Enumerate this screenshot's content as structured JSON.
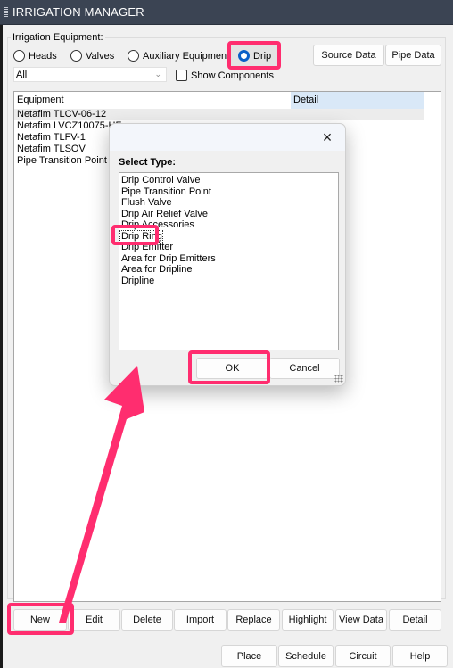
{
  "window": {
    "title": "IRRIGATION MANAGER"
  },
  "equipment_group": {
    "label": "Irrigation Equipment:",
    "radios": [
      {
        "label": "Heads",
        "selected": false
      },
      {
        "label": "Valves",
        "selected": false
      },
      {
        "label": "Auxiliary Equipment",
        "selected": false
      },
      {
        "label": "Drip",
        "selected": true
      }
    ],
    "filter_select": {
      "value": "All"
    },
    "show_components": {
      "label": "Show Components",
      "checked": false
    },
    "source_data_label": "Source Data",
    "pipe_data_label": "Pipe Data"
  },
  "equipment_list": {
    "columns": [
      "Equipment",
      "Detail"
    ],
    "rows": [
      {
        "equipment": "Netafim TLCV-06-12",
        "detail": "",
        "selected": true
      },
      {
        "equipment": "Netafim LVCZ10075-HF",
        "detail": ""
      },
      {
        "equipment": "Netafim TLFV-1",
        "detail": ""
      },
      {
        "equipment": "Netafim TLSOV",
        "detail": ""
      },
      {
        "equipment": "Pipe Transition Point ab",
        "detail": ""
      }
    ]
  },
  "actions": {
    "row1": [
      "New",
      "Edit",
      "Delete",
      "Import",
      "Replace",
      "Highlight",
      "View Data",
      "Detail"
    ],
    "row2": [
      "Place",
      "Schedule",
      "Circuit",
      "Help"
    ]
  },
  "dialog": {
    "close_icon": "×",
    "label": "Select Type:",
    "items": [
      "Drip Control Valve",
      "Pipe Transition Point",
      "Flush Valve",
      "Drip Air Relief Valve",
      "Drip Accessories",
      "Drip Ring",
      "Drip Emitter",
      "Area for Drip Emitters",
      "Area for Dripline",
      "Dripline"
    ],
    "selected_item": "Drip Ring",
    "ok_label": "OK",
    "cancel_label": "Cancel"
  },
  "annotations": {
    "highlight_color": "#ff2d6f",
    "arrow": "from New button to OK button"
  },
  "colors": {
    "titlebar": "#3b4453",
    "radio_selected": "#0a5fc7",
    "header_detail_bg": "#d9e8f7"
  }
}
